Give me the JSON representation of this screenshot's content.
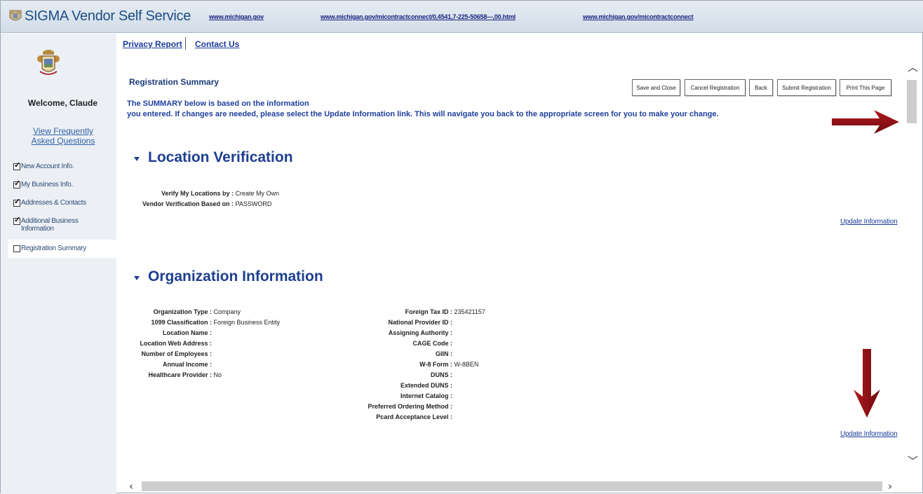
{
  "header": {
    "app_title": "SIGMA Vendor Self Service",
    "links": [
      "www.michigan.gov",
      "www.michigan.gov/micontractconnect/0,4541,7-225-50658---,00.html",
      "www.michigan.gov/micontractconnect"
    ]
  },
  "sidebar": {
    "welcome": "Welcome, Claude",
    "faq_link": "View Frequently Asked Questions",
    "steps": [
      {
        "label": "New Account Info.",
        "checked": true
      },
      {
        "label": "My Business Info.",
        "checked": true
      },
      {
        "label": "Addresses & Contacts",
        "checked": true
      },
      {
        "label": "Additional Business Information",
        "checked": true
      },
      {
        "label": "Registration Summary",
        "checked": false
      }
    ]
  },
  "toplinks": {
    "privacy": "Privacy Report",
    "contact": "Contact Us"
  },
  "page": {
    "title": "Registration Summary",
    "intro_line1": "The SUMMARY below is based on the information",
    "intro_line2": "you entered. If changes are needed, please select the Update Information link. This will navigate you back to the appropriate screen for you to make your change."
  },
  "buttons": {
    "save_close": "Save and Close",
    "cancel": "Cancel Registration",
    "back": "Back",
    "submit": "Submit Registration",
    "print": "Print This Page"
  },
  "location": {
    "title": "Location Verification",
    "fields": [
      {
        "label": "Verify My Locations by :",
        "value": "Create My Own"
      },
      {
        "label": "Vendor Verification Based on :",
        "value": "PASSWORD"
      }
    ],
    "update": "Update Information"
  },
  "organization": {
    "title": "Organization Information",
    "left_fields": [
      {
        "label": "Organization Type :",
        "value": "Company"
      },
      {
        "label": "1099 Classification :",
        "value": "Foreign Business Entity"
      },
      {
        "label": "Location Name :",
        "value": ""
      },
      {
        "label": "Location Web Address :",
        "value": ""
      },
      {
        "label": "Number of Employees :",
        "value": ""
      },
      {
        "label": "Annual Income :",
        "value": ""
      },
      {
        "label": "Healthcare Provider :",
        "value": "No"
      }
    ],
    "right_fields": [
      {
        "label": "Foreign Tax ID :",
        "value": "235421157"
      },
      {
        "label": "National Provider ID :",
        "value": ""
      },
      {
        "label": "Assigning Authority :",
        "value": ""
      },
      {
        "label": "CAGE Code :",
        "value": ""
      },
      {
        "label": "GIIN :",
        "value": ""
      },
      {
        "label": "W-8 Form :",
        "value": "W-8BEN"
      },
      {
        "label": "DUNS :",
        "value": ""
      },
      {
        "label": "Extended DUNS :",
        "value": ""
      },
      {
        "label": "Internet Catalog :",
        "value": ""
      },
      {
        "label": "Preferred Ordering Method :",
        "value": ""
      },
      {
        "label": "Pcard Acceptance Level :",
        "value": ""
      }
    ],
    "update": "Update Information"
  },
  "colors": {
    "arrow": "#8b0d12",
    "heading": "#1e3f8f",
    "link": "#1a3a9a"
  }
}
